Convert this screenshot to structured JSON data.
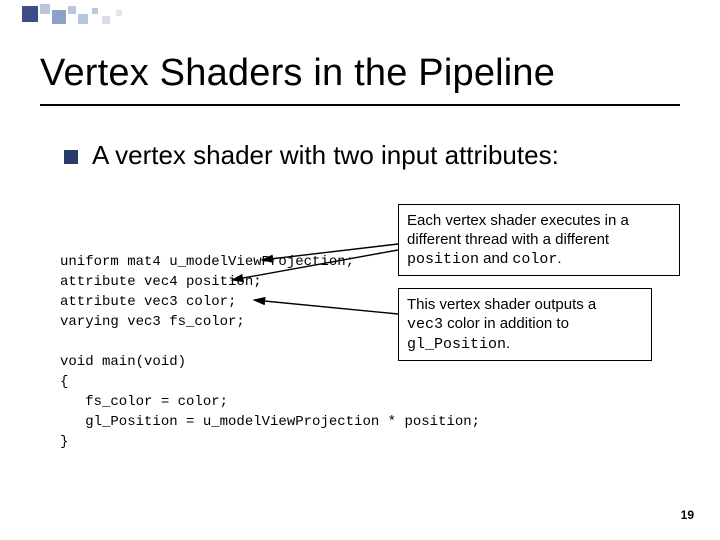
{
  "title": "Vertex Shaders in the Pipeline",
  "bullet": "A vertex shader with two input attributes:",
  "code": {
    "l1": "uniform mat4 u_modelViewProjection;",
    "l2": "attribute vec4 position;",
    "l3": "attribute vec3 color;",
    "l4": "varying vec3 fs_color;",
    "l5": "",
    "l6": "void main(void)",
    "l7": "{",
    "l8": "   fs_color = color;",
    "l9": "   gl_Position = u_modelViewProjection * position;",
    "l10": "}"
  },
  "box1": {
    "t1": "Each vertex shader executes in a",
    "t2": "different thread with a different",
    "m1": "position",
    "t3": " and ",
    "m2": "color",
    "t4": "."
  },
  "box2": {
    "t1": "This vertex shader outputs a",
    "m1": "vec3",
    "t2": " color in addition to",
    "m2": "gl_Position",
    "t3": "."
  },
  "page_number": "19"
}
